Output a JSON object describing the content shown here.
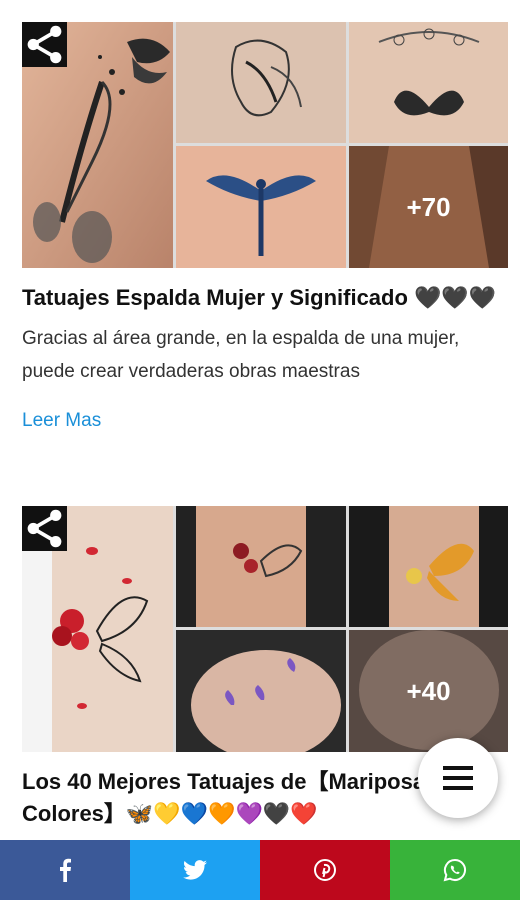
{
  "articles": [
    {
      "title": "Tatuajes Espalda Mujer y Significado 🖤🖤🖤",
      "description": "Gracias al área grande, en la espalda de una mujer, puede crear verdaderas obras maestras",
      "read_more": "Leer Mas",
      "more_count": "+70"
    },
    {
      "title": "Los 40 Mejores Tatuajes de【Mariposas y Colores】🦋💛💙🧡💜🖤❤️",
      "more_count": "+40"
    }
  ],
  "icons": {
    "share": "share-icon",
    "menu": "hamburger-menu-icon",
    "facebook": "facebook-icon",
    "twitter": "twitter-icon",
    "pinterest": "pinterest-icon",
    "whatsapp": "whatsapp-icon"
  },
  "colors": {
    "facebook": "#3b5998",
    "twitter": "#1da1f2",
    "pinterest": "#bd081c",
    "whatsapp": "#38b33a",
    "link": "#1a8fd8"
  }
}
